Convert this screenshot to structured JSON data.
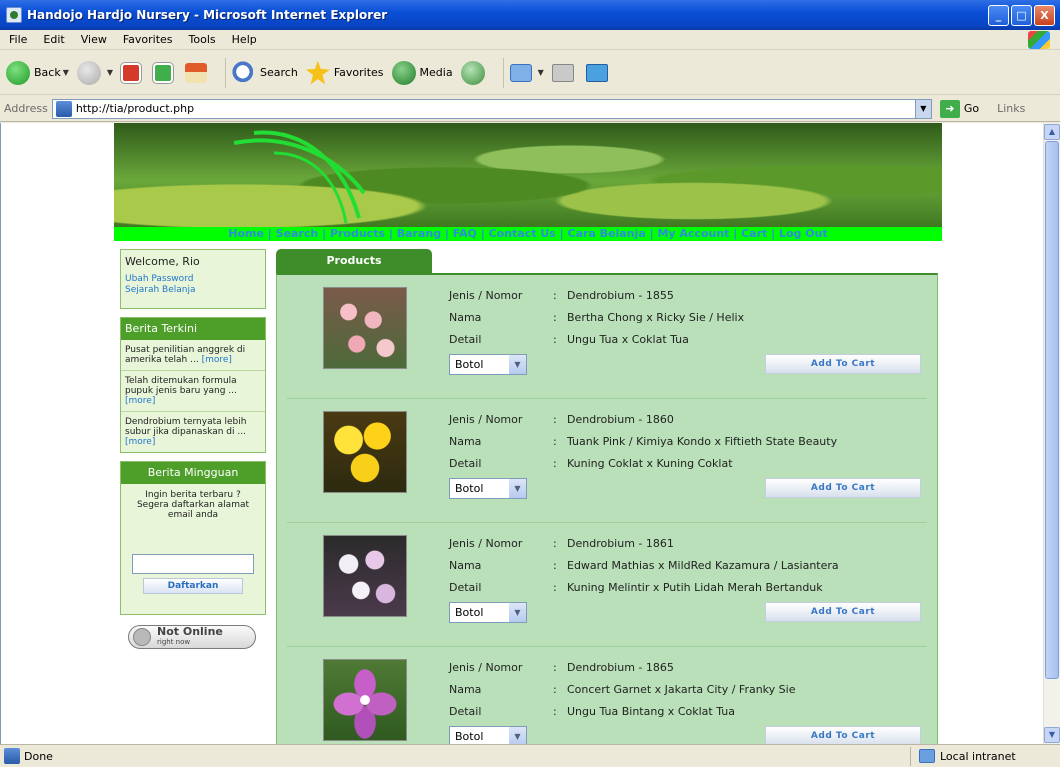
{
  "window": {
    "title": "Handojo Hardjo Nursery - Microsoft Internet Explorer",
    "controls": [
      "_",
      "□",
      "X"
    ]
  },
  "menu": [
    "File",
    "Edit",
    "View",
    "Favorites",
    "Tools",
    "Help"
  ],
  "toolbar": {
    "back": "Back",
    "search": "Search",
    "favorites": "Favorites",
    "media": "Media"
  },
  "address": {
    "label": "Address",
    "url": "http://tia/product.php",
    "go": "Go",
    "links": "Links"
  },
  "nav": [
    "Home",
    "Search",
    "Products",
    "Barang",
    "FAQ",
    "Contact Us",
    "Cara Belanja",
    "My Account",
    "Cart",
    "Log Out"
  ],
  "sidebar": {
    "welcome": "Welcome, Rio",
    "links": [
      "Ubah Password",
      "Sejarah Belanja"
    ],
    "berita_title": "Berita Terkini",
    "berita": [
      {
        "text": "Pusat penilitian anggrek di amerika telah ...",
        "more": "[more]"
      },
      {
        "text": "Telah ditemukan formula pupuk jenis baru yang ...",
        "more": "[more]"
      },
      {
        "text": "Dendrobium ternyata lebih subur jika dipanaskan di ...",
        "more": "[more]"
      }
    ],
    "mingguan_title": "Berita Mingguan",
    "mingguan_text": "Ingin berita terbaru ? Segera daftarkan alamat email anda",
    "daftar_button": "Daftarkan",
    "online_title": "Not Online",
    "online_sub": "right now"
  },
  "products": {
    "tab": "Products",
    "labels": {
      "jenis": "Jenis / Nomor",
      "nama": "Nama",
      "detail": "Detail"
    },
    "colon": ":",
    "add_button": "Add To Cart",
    "items": [
      {
        "jenis": "Dendrobium - 1855",
        "nama": "Bertha Chong x Ricky Sie / Helix",
        "detail": "Ungu Tua x Coklat Tua",
        "option": "Botol"
      },
      {
        "jenis": "Dendrobium - 1860",
        "nama": "Tuank Pink / Kimiya Kondo x Fiftieth State Beauty",
        "detail": "Kuning Coklat x Kuning Coklat",
        "option": "Botol"
      },
      {
        "jenis": "Dendrobium - 1861",
        "nama": "Edward Mathias x MildRed Kazamura / Lasiantera",
        "detail": "Kuning Melintir x Putih Lidah Merah Bertanduk",
        "option": "Botol"
      },
      {
        "jenis": "Dendrobium - 1865",
        "nama": "Concert Garnet x Jakarta City / Franky Sie",
        "detail": "Ungu Tua Bintang x Coklat Tua",
        "option": "Botol"
      }
    ]
  },
  "status": {
    "left": "Done",
    "zone": "Local intranet"
  }
}
